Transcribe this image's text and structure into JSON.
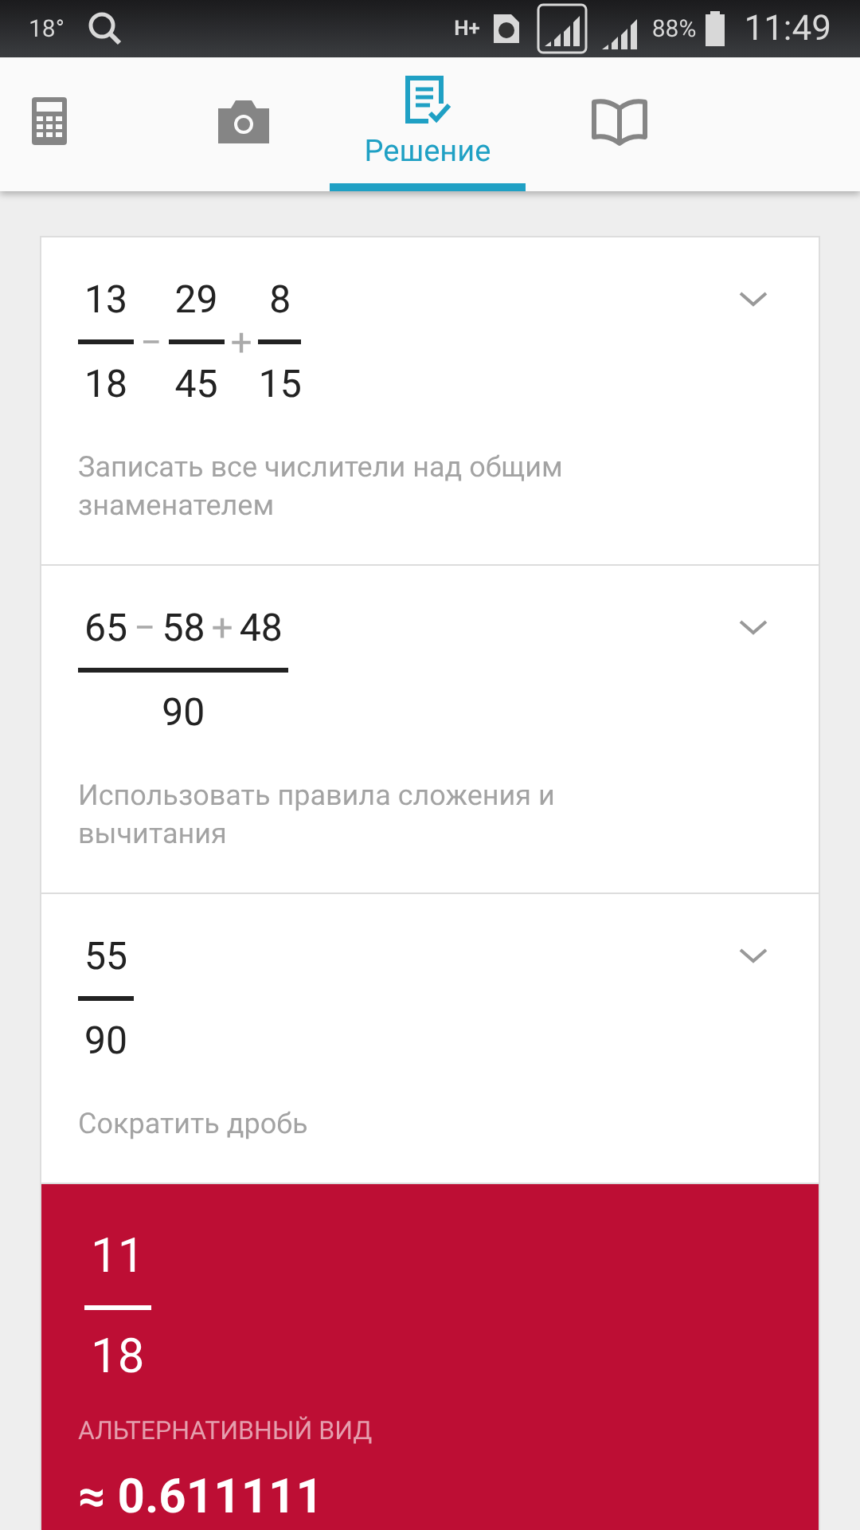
{
  "status_bar": {
    "temperature": "18°",
    "network": "H+",
    "battery": "88%",
    "time": "11:49"
  },
  "tabs": [
    {
      "kind": "calculator",
      "selected": false
    },
    {
      "kind": "camera",
      "selected": false
    },
    {
      "kind": "solution",
      "label": "Решение",
      "selected": true
    },
    {
      "kind": "book",
      "selected": false
    }
  ],
  "steps": [
    {
      "expression": [
        {
          "kind": "fraction",
          "numerator": [
            {
              "kind": "number",
              "text": "13"
            }
          ],
          "denominator": "18"
        },
        {
          "kind": "operator",
          "text": "−"
        },
        {
          "kind": "fraction",
          "numerator": [
            {
              "kind": "number",
              "text": "29"
            }
          ],
          "denominator": "45"
        },
        {
          "kind": "operator",
          "text": "+"
        },
        {
          "kind": "fraction",
          "numerator": [
            {
              "kind": "number",
              "text": "8"
            }
          ],
          "denominator": "15"
        }
      ],
      "description": "Записать все числители над общим знаменателем",
      "expanded": false
    },
    {
      "expression": [
        {
          "kind": "fraction",
          "numerator": [
            {
              "kind": "number",
              "text": "65"
            },
            {
              "kind": "operator",
              "text": "−"
            },
            {
              "kind": "number",
              "text": "58"
            },
            {
              "kind": "operator",
              "text": "+"
            },
            {
              "kind": "number",
              "text": "48"
            }
          ],
          "denominator": "90"
        }
      ],
      "description": "Использовать правила сложения и вычитания",
      "expanded": false
    },
    {
      "expression": [
        {
          "kind": "fraction",
          "numerator": [
            {
              "kind": "number",
              "text": "55"
            }
          ],
          "denominator": "90"
        }
      ],
      "description": "Сократить дробь",
      "expanded": false
    }
  ],
  "result": {
    "expression": [
      {
        "kind": "fraction",
        "numerator": [
          {
            "kind": "number",
            "text": "11"
          }
        ],
        "denominator": "18"
      }
    ],
    "alternative_label": "АЛЬТЕРНАТИВНЫЙ ВИД",
    "alternative_value": "≈ 0.611111"
  }
}
